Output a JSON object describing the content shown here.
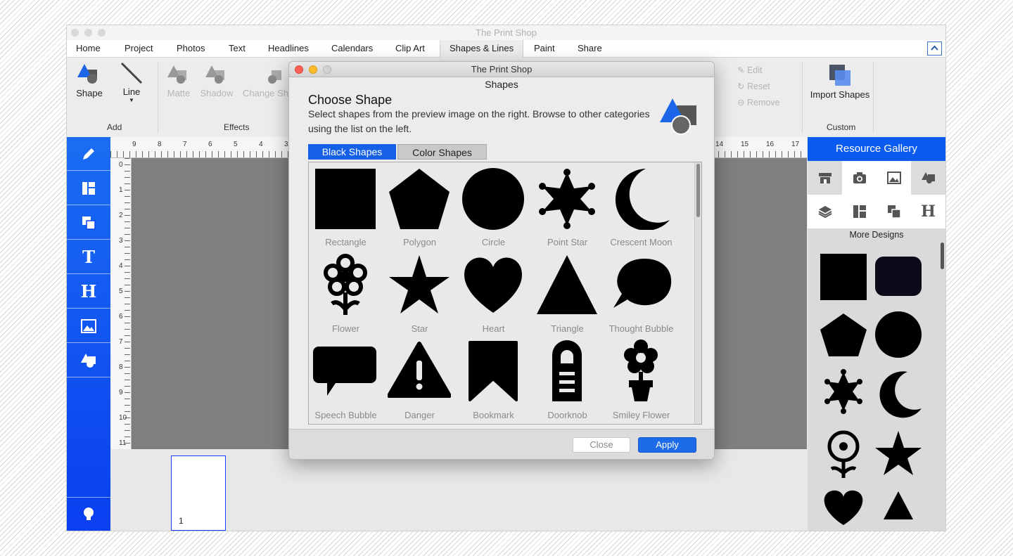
{
  "app": {
    "title": "The Print Shop"
  },
  "menu_tabs": [
    "Home",
    "Project",
    "Photos",
    "Text",
    "Headlines",
    "Calendars",
    "Clip Art",
    "Shapes & Lines",
    "Paint",
    "Share"
  ],
  "active_tab": "Shapes & Lines",
  "ribbon": {
    "shape_label": "Shape",
    "line_label": "Line",
    "matte_label": "Matte",
    "shadow_label": "Shadow",
    "change_shape_label": "Change Sh",
    "edit_label": "Edit",
    "reset_label": "Reset",
    "remove_label": "Remove",
    "import_shapes_label": "Import Shapes",
    "groups": {
      "add": "Add",
      "effects": "Effects",
      "custom": "Custom"
    }
  },
  "left_toolbar": {
    "text_tool_glyph": "T",
    "headline_tool_glyph": "H",
    "items": [
      "pencil-icon",
      "layout-icon",
      "layers-icon",
      "text-tool-icon",
      "headline-tool-icon",
      "photo-icon",
      "shapes-icon",
      "lightbulb-icon"
    ]
  },
  "rulers": {
    "horizontal_left": [
      "9",
      "8",
      "7",
      "6",
      "5",
      "4",
      "3"
    ],
    "horizontal_right": [
      "14",
      "15",
      "16",
      "17"
    ],
    "vertical": [
      "0",
      "1",
      "2",
      "3",
      "4",
      "5",
      "6",
      "7",
      "8",
      "9",
      "10",
      "11"
    ]
  },
  "zoom": {
    "plus": "+",
    "minus": "−"
  },
  "pages": {
    "current_page": "1"
  },
  "gallery": {
    "title": "Resource Gallery",
    "headline_glyph": "H",
    "more_designs_label": "More Designs",
    "icons": [
      "store-icon",
      "camera-icon",
      "image-icon",
      "shapes-icon",
      "layers-icon",
      "layout-icon",
      "page-icon",
      "headline-icon"
    ]
  },
  "dialog": {
    "window_title": "The Print Shop",
    "subtitle": "Shapes",
    "heading": "Choose Shape",
    "description": "Select shapes from the preview image on the right. Browse to other categories using the list on the left.",
    "tabs": [
      "Black Shapes",
      "Color Shapes"
    ],
    "active_tab": "Black Shapes",
    "shapes": [
      "Rectangle",
      "Polygon",
      "Circle",
      "Point Star",
      "Crescent Moon",
      "Flower",
      "Star",
      "Heart",
      "Triangle",
      "Thought Bubble",
      "Speech Bubble",
      "Danger",
      "Bookmark",
      "Doorknob",
      "Smiley Flower"
    ],
    "close_label": "Close",
    "apply_label": "Apply"
  },
  "colors": {
    "accent": "#1560e6",
    "toolbar_blue": "#0a44f0",
    "canvas_gray": "#7f7f7f"
  }
}
